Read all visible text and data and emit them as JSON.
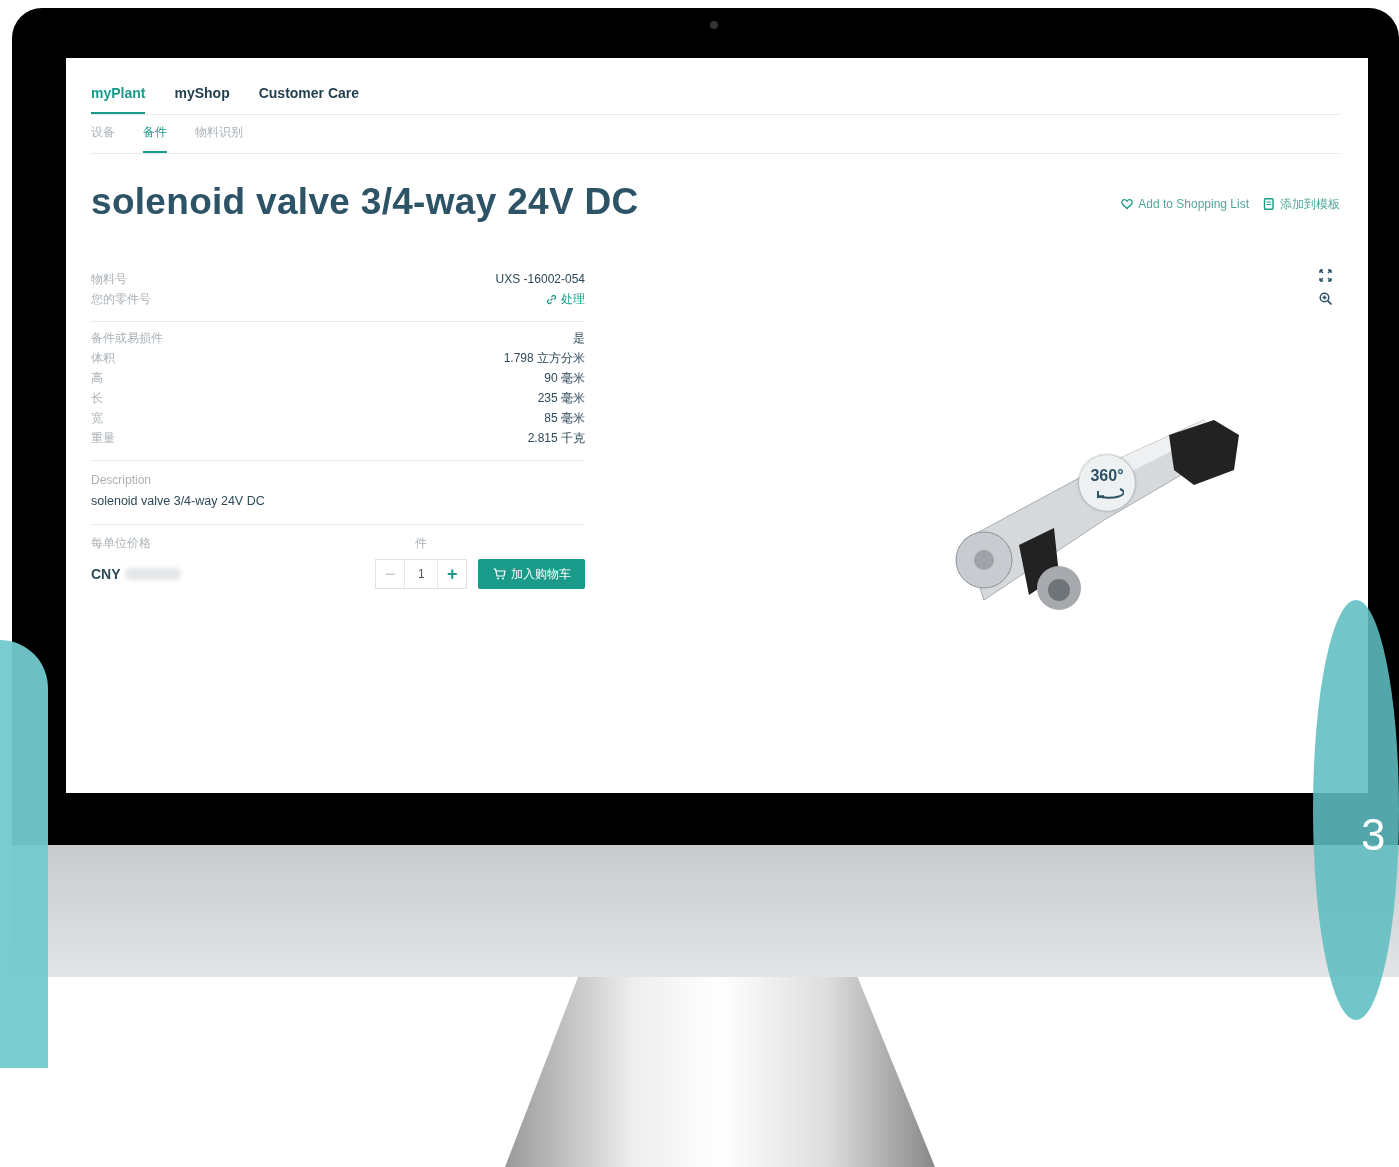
{
  "nav": {
    "tabs": [
      {
        "label": "myPlant",
        "selected": true
      },
      {
        "label": "myShop",
        "selected": false
      },
      {
        "label": "Customer Care",
        "selected": false
      }
    ]
  },
  "subnav": {
    "tabs": [
      {
        "label": "设备",
        "selected": false
      },
      {
        "label": "备件",
        "selected": true
      },
      {
        "label": "物料识别",
        "selected": false
      }
    ]
  },
  "title": "solenoid valve 3/4-way 24V DC",
  "actions": [
    {
      "kind": "favorite",
      "label": "Add to Shopping List"
    },
    {
      "kind": "template",
      "label": "添加到模板"
    }
  ],
  "image_tools": [
    {
      "kind": "fullscreen"
    },
    {
      "kind": "zoom"
    }
  ],
  "groups": [
    {
      "rows": [
        {
          "label": "物料号",
          "value": "UXS -16002-054",
          "kind": "text"
        },
        {
          "label": "您的零件号",
          "value": "处理",
          "kind": "link"
        }
      ]
    },
    {
      "rows": [
        {
          "label": "备件或易损件",
          "value": "是",
          "kind": "text"
        },
        {
          "label": "体积",
          "value": "1.798 立方分米",
          "kind": "text"
        },
        {
          "label": "高",
          "value": "90 毫米",
          "kind": "text"
        },
        {
          "label": "长",
          "value": "235 毫米",
          "kind": "text"
        },
        {
          "label": "宽",
          "value": "85 毫米",
          "kind": "text"
        },
        {
          "label": "重量",
          "value": "2.815 千克",
          "kind": "text"
        }
      ]
    }
  ],
  "description": {
    "label": "Description",
    "text": "solenoid valve 3/4-way 24V DC"
  },
  "price": {
    "label": "每单位价格",
    "currency": "CNY",
    "qty_label": "件",
    "minus": "−",
    "quantity": "1",
    "plus": "+",
    "cart_button": "加入购物车"
  },
  "product_image": {
    "badge": "360°"
  },
  "decoration": {
    "text": "3"
  }
}
